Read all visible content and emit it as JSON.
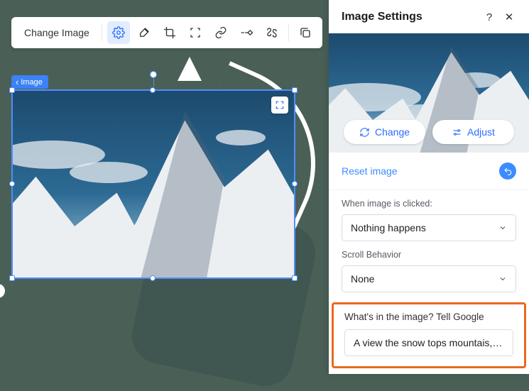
{
  "toolbar": {
    "change_image": "Change Image",
    "icons": [
      "gear-icon",
      "brush-icon",
      "crop-icon",
      "focus-icon",
      "link-icon",
      "animation-icon",
      "swap-icon",
      "duplicate-icon"
    ]
  },
  "breadcrumb": {
    "label": "Image"
  },
  "panel": {
    "title": "Image Settings",
    "change": "Change",
    "adjust": "Adjust",
    "reset": "Reset image",
    "click_label": "When image is clicked:",
    "click_value": "Nothing happens",
    "scroll_label": "Scroll Behavior",
    "scroll_value": "None",
    "alt_label": "What's in the image? Tell Google",
    "alt_value": "A view the snow tops mountais, ever…"
  }
}
